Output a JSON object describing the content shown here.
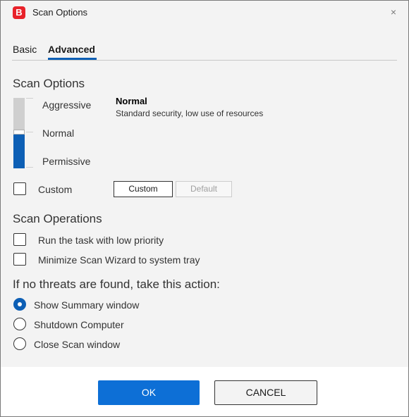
{
  "window": {
    "title": "Scan Options",
    "app_icon_letter": "B",
    "close_glyph": "×",
    "brand_color": "#e8222a"
  },
  "tabs": [
    {
      "label": "Basic",
      "active": false
    },
    {
      "label": "Advanced",
      "active": true
    }
  ],
  "scan_options": {
    "title": "Scan Options",
    "levels": [
      "Aggressive",
      "Normal",
      "Permissive"
    ],
    "selected_level": "Normal",
    "selected_name": "Normal",
    "selected_description": "Standard security, low use of resources",
    "custom_checkbox": {
      "label": "Custom",
      "checked": false
    },
    "custom_button": "Custom",
    "default_button": "Default"
  },
  "scan_operations": {
    "title": "Scan Operations",
    "options": [
      {
        "label": "Run the task with low priority",
        "checked": false
      },
      {
        "label": "Minimize Scan Wizard to system tray",
        "checked": false
      }
    ]
  },
  "no_threats": {
    "title": "If no threats are found, take this action:",
    "options": [
      {
        "label": "Show Summary window",
        "selected": true
      },
      {
        "label": "Shutdown Computer",
        "selected": false
      },
      {
        "label": "Close Scan window",
        "selected": false
      }
    ]
  },
  "footer": {
    "ok": "OK",
    "cancel": "CANCEL"
  },
  "colors": {
    "accent": "#0d5fb5",
    "ok_button": "#0d6fd6"
  }
}
